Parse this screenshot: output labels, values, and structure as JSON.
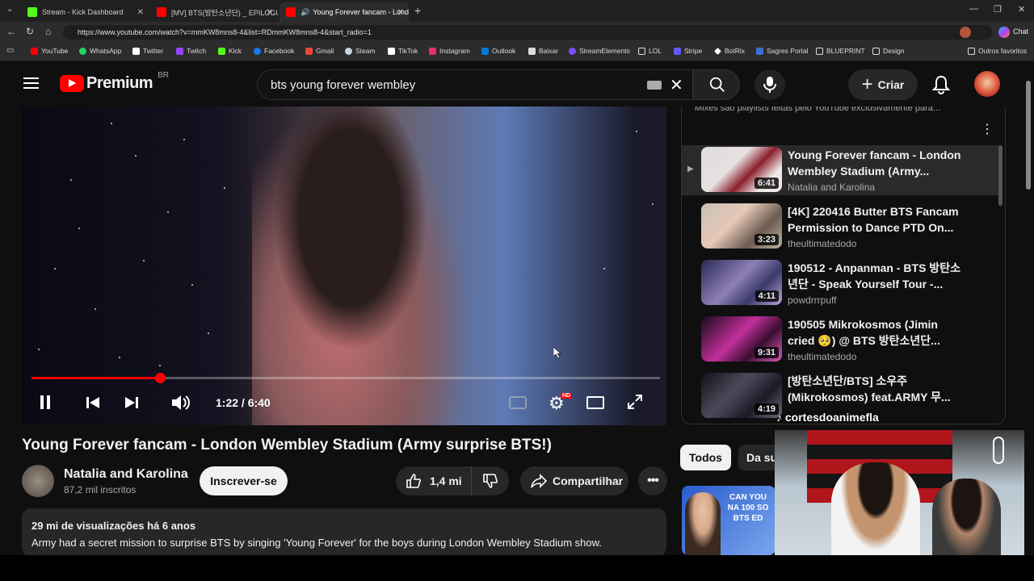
{
  "tabs": [
    {
      "label": "Stream - Kick Dashboard",
      "color": "#53fc18"
    },
    {
      "label": "[MV] BTS(방탄소년단) _ EPILOGUE",
      "color": "#ff0000"
    },
    {
      "label": "Young Forever fancam - Lond",
      "color": "#ff0000"
    }
  ],
  "browser": {
    "url": "https://www.youtube.com/watch?v=mmKW8mns8-4&list=RDmmKW8mns8-4&start_radio=1",
    "chat_label": "Chat"
  },
  "bookmarks": [
    {
      "label": "YouTube",
      "color": "#ff0000"
    },
    {
      "label": "WhatsApp",
      "color": "#25d366"
    },
    {
      "label": "Twitter",
      "color": "#ffffff"
    },
    {
      "label": "Twitch",
      "color": "#9146ff"
    },
    {
      "label": "Kick",
      "color": "#53fc18"
    },
    {
      "label": "Facebook",
      "color": "#1877f2"
    },
    {
      "label": "Gmail",
      "color": "#ea4335"
    },
    {
      "label": "Steam",
      "color": "#c7d5e0"
    },
    {
      "label": "TikTok",
      "color": "#ffffff"
    },
    {
      "label": "Instagram",
      "color": "#e1306c"
    },
    {
      "label": "Outlook",
      "color": "#0078d4"
    },
    {
      "label": "Baixar",
      "color": "#dddddd"
    },
    {
      "label": "StreamElements",
      "color": "#7c4dff"
    },
    {
      "label": "LOL",
      "color": "#c89b3c"
    },
    {
      "label": "Stripe",
      "color": "#635bff"
    },
    {
      "label": "BotRix",
      "color": "#ffffff"
    },
    {
      "label": "Sagres Portal",
      "color": "#3a6fd8"
    },
    {
      "label": "BLUEPRINT",
      "color": "#dddddd"
    },
    {
      "label": "Design",
      "color": "#dddddd"
    },
    {
      "label": "Outros favoritos",
      "color": "#dddddd"
    }
  ],
  "header": {
    "logo_text": "Premium",
    "region": "BR",
    "search_query": "bts young forever wembley",
    "create_label": "Criar"
  },
  "player": {
    "time_display": "1:22 / 6:40",
    "progress": 0.205,
    "hd_badge": "HD"
  },
  "video": {
    "title": "Young Forever fancam - London Wembley Stadium (Army surprise BTS!)",
    "channel": "Natalia and Karolina",
    "subscribers": "87,2 mil inscritos",
    "subscribe_label": "Inscrever-se",
    "likes": "1,4 mi",
    "share_label": "Compartilhar",
    "meta": "29 mi de visualizações  há 6 anos",
    "description": "Army had a secret mission to surprise BTS by singing 'Young Forever' for the boys during London Wembley Stadium show."
  },
  "playlist": {
    "header_text": "Mixes são playlists feitas pelo YouTube exclusivamente para...",
    "items": [
      {
        "title": "Young Forever fancam - London Wembley Stadium (Army...",
        "channel": "Natalia and Karolina",
        "duration": "6:41"
      },
      {
        "title": "[4K] 220416 Butter BTS Fancam Permission to Dance PTD On...",
        "channel": "theultimatedodo",
        "duration": "3:23"
      },
      {
        "title": "190512 - Anpanman - BTS 방탄소년단 - Speak Yourself Tour -...",
        "channel": "powdrrrpuff",
        "duration": "4:11"
      },
      {
        "title": "190505 Mikrokosmos (Jimin cried 🥺) @ BTS 방탄소년단...",
        "channel": "theultimatedodo",
        "duration": "9:31"
      },
      {
        "title": "[방탄소년단/BTS] 소우주 (Mikrokosmos) feat.ARMY 무...",
        "channel": "",
        "duration": "4:19"
      }
    ]
  },
  "chips": {
    "all": "Todos",
    "second": "Da sua"
  },
  "recommendation": {
    "thumb_text": "CAN YOU NA 100 SO BTS ED"
  },
  "webcam": {
    "tag": "cortesdoanimefla"
  }
}
